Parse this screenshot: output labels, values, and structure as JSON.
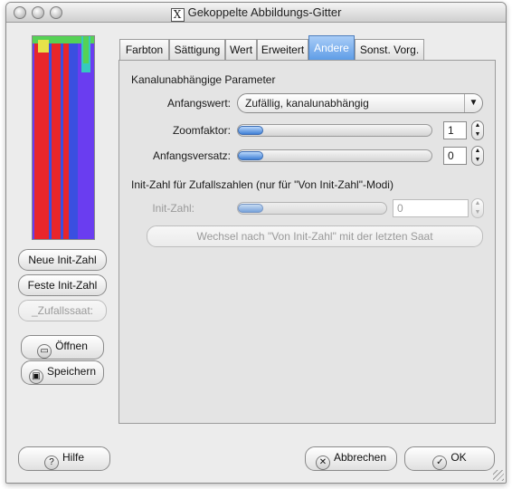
{
  "window": {
    "title": "Gekoppelte Abbildungs-Gitter"
  },
  "preview": {
    "colors": {
      "background": "#6a3df0",
      "red": "#e8262a",
      "blue": "#3a4fe0",
      "green": "#55d255",
      "yellow": "#e6e24a",
      "cyan": "#36c8c0"
    }
  },
  "left_buttons": {
    "new_seed": "Neue Init-Zahl",
    "fixed_seed": "Feste Init-Zahl",
    "random_seed": "_Zufallssaat:",
    "open": "Öffnen",
    "save": "Speichern"
  },
  "tabs": [
    {
      "label": "Farbton",
      "active": false
    },
    {
      "label": "Sättigung",
      "active": false
    },
    {
      "label": "Wert",
      "active": false
    },
    {
      "label": "Erweitert",
      "active": false
    },
    {
      "label": "Andere",
      "active": true
    },
    {
      "label": "Sonst. Vorg.",
      "active": false
    }
  ],
  "section_channel": {
    "heading": "Kanalunabhängige Parameter",
    "initial_value_label": "Anfangswert:",
    "initial_value_selected": "Zufällig, kanalunabhängig",
    "zoom_label": "Zoomfaktor:",
    "zoom_value": "1",
    "offset_label": "Anfangsversatz:",
    "offset_value": "0"
  },
  "section_seed": {
    "heading": "Init-Zahl für Zufallszahlen (nur für \"Von Init-Zahl\"-Modi)",
    "seed_label": "Init-Zahl:",
    "seed_value": "0",
    "switch_button": "Wechsel nach \"Von Init-Zahl\" mit der letzten Saat"
  },
  "footer": {
    "help": "Hilfe",
    "cancel": "Abbrechen",
    "ok": "OK"
  }
}
